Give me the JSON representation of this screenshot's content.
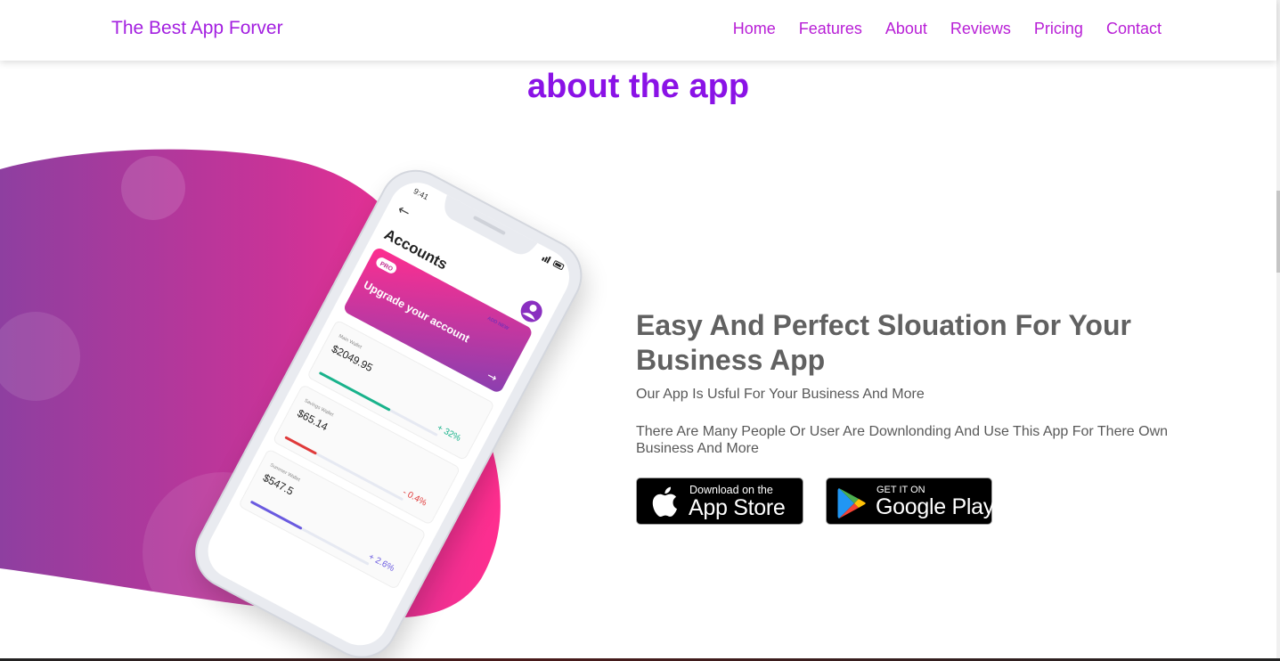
{
  "navbar": {
    "brand": "The Best App Forver",
    "links": [
      "Home",
      "Features",
      "About",
      "Reviews",
      "Pricing",
      "Contact"
    ]
  },
  "section": {
    "title": "about the app"
  },
  "content": {
    "headline": "Easy And Perfect Slouation For Your Business App",
    "subline": "Our App Is Usful For Your Business And More",
    "body": "There Are Many People Or User Are Downlonding And Use This App For There Own Business And More"
  },
  "store_buttons": {
    "appstore_small": "Download on the",
    "appstore_big": "App Store",
    "googleplay_small": "GET IT ON",
    "googleplay_big": "Google Play"
  },
  "phone": {
    "time": "9:41",
    "screen_title": "Accounts",
    "badge": "PRO",
    "upgrade_text": "Upgrade your account",
    "add_new": "ADD NEW",
    "wallets": [
      {
        "name": "Main Wallet",
        "amount": "$2049.95",
        "change": "+ 32%",
        "color": "#19b38b"
      },
      {
        "name": "Savings Wallet",
        "amount": "$65.14",
        "change": "- 0.4%",
        "color": "#e03a3a"
      },
      {
        "name": "Summer Wallet",
        "amount": "$547.5",
        "change": "+ 2.6%",
        "color": "#6a5ae0"
      }
    ]
  },
  "colors": {
    "brand": "#a31fe0",
    "nav_link": "#b81fd6",
    "title": "#8a12e6",
    "blob_start": "#8e3fa0",
    "blob_end": "#ff2e8f"
  }
}
